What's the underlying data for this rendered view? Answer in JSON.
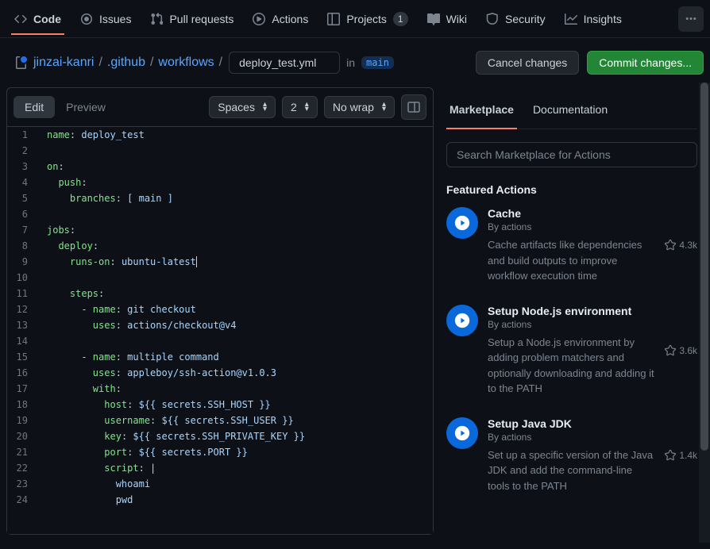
{
  "nav": {
    "code": "Code",
    "issues": "Issues",
    "pulls": "Pull requests",
    "actions": "Actions",
    "projects": "Projects",
    "projects_count": "1",
    "wiki": "Wiki",
    "security": "Security",
    "insights": "Insights"
  },
  "breadcrumb": {
    "repo": "jinzai-kanri",
    "dir1": ".github",
    "dir2": "workflows",
    "filename": "deploy_test.yml",
    "in": "in",
    "branch": "main"
  },
  "buttons": {
    "cancel": "Cancel changes",
    "commit": "Commit changes..."
  },
  "editor": {
    "edit_tab": "Edit",
    "preview_tab": "Preview",
    "indent": "Spaces",
    "indent_size": "2",
    "wrap": "No wrap"
  },
  "sidebar": {
    "marketplace_tab": "Marketplace",
    "docs_tab": "Documentation",
    "search_placeholder": "Search Marketplace for Actions",
    "featured_title": "Featured Actions",
    "actions": [
      {
        "title": "Cache",
        "author": "By actions",
        "desc": "Cache artifacts like dependencies and build outputs to improve workflow execution time",
        "stars": "4.3k"
      },
      {
        "title": "Setup Node.js environment",
        "author": "By actions",
        "desc": "Setup a Node.js environment by adding problem matchers and optionally downloading and adding it to the PATH",
        "stars": "3.6k"
      },
      {
        "title": "Setup Java JDK",
        "author": "By actions",
        "desc": "Set up a specific version of the Java JDK and add the command-line tools to the PATH",
        "stars": "1.4k"
      }
    ]
  },
  "code": [
    [
      [
        "key",
        "name"
      ],
      [
        "",
        ": "
      ],
      [
        "str",
        "deploy_test"
      ]
    ],
    [],
    [
      [
        "key",
        "on"
      ],
      [
        "",
        ":"
      ]
    ],
    [
      [
        "",
        "  "
      ],
      [
        "key",
        "push"
      ],
      [
        "",
        ":"
      ]
    ],
    [
      [
        "",
        "    "
      ],
      [
        "key",
        "branches"
      ],
      [
        "",
        ": "
      ],
      [
        "str",
        "[ main ]"
      ]
    ],
    [],
    [
      [
        "key",
        "jobs"
      ],
      [
        "",
        ":"
      ]
    ],
    [
      [
        "",
        "  "
      ],
      [
        "key",
        "deploy"
      ],
      [
        "",
        ":"
      ]
    ],
    [
      [
        "",
        "    "
      ],
      [
        "key",
        "runs-on"
      ],
      [
        "",
        ": "
      ],
      [
        "str",
        "ubuntu-latest"
      ],
      [
        "cursor",
        ""
      ]
    ],
    [],
    [
      [
        "",
        "    "
      ],
      [
        "key",
        "steps"
      ],
      [
        "",
        ":"
      ]
    ],
    [
      [
        "",
        "      - "
      ],
      [
        "key",
        "name"
      ],
      [
        "",
        ": "
      ],
      [
        "str",
        "git checkout"
      ]
    ],
    [
      [
        "",
        "        "
      ],
      [
        "key",
        "uses"
      ],
      [
        "",
        ": "
      ],
      [
        "str",
        "actions/checkout@v4"
      ]
    ],
    [],
    [
      [
        "",
        "      - "
      ],
      [
        "key",
        "name"
      ],
      [
        "",
        ": "
      ],
      [
        "str",
        "multiple command"
      ]
    ],
    [
      [
        "",
        "        "
      ],
      [
        "key",
        "uses"
      ],
      [
        "",
        ": "
      ],
      [
        "str",
        "appleboy/ssh-action@v1.0.3"
      ]
    ],
    [
      [
        "",
        "        "
      ],
      [
        "key",
        "with"
      ],
      [
        "",
        ":"
      ]
    ],
    [
      [
        "",
        "          "
      ],
      [
        "key",
        "host"
      ],
      [
        "",
        ": "
      ],
      [
        "str",
        "${{ secrets.SSH_HOST }}"
      ]
    ],
    [
      [
        "",
        "          "
      ],
      [
        "key",
        "username"
      ],
      [
        "",
        ": "
      ],
      [
        "str",
        "${{ secrets.SSH_USER }}"
      ]
    ],
    [
      [
        "",
        "          "
      ],
      [
        "key",
        "key"
      ],
      [
        "",
        ": "
      ],
      [
        "str",
        "${{ secrets.SSH_PRIVATE_KEY }}"
      ]
    ],
    [
      [
        "",
        "          "
      ],
      [
        "key",
        "port"
      ],
      [
        "",
        ": "
      ],
      [
        "str",
        "${{ secrets.PORT }}"
      ]
    ],
    [
      [
        "",
        "          "
      ],
      [
        "key",
        "script"
      ],
      [
        "",
        ": |"
      ]
    ],
    [
      [
        "",
        "            "
      ],
      [
        "str",
        "whoami"
      ]
    ],
    [
      [
        "",
        "            "
      ],
      [
        "str",
        "pwd"
      ]
    ]
  ]
}
